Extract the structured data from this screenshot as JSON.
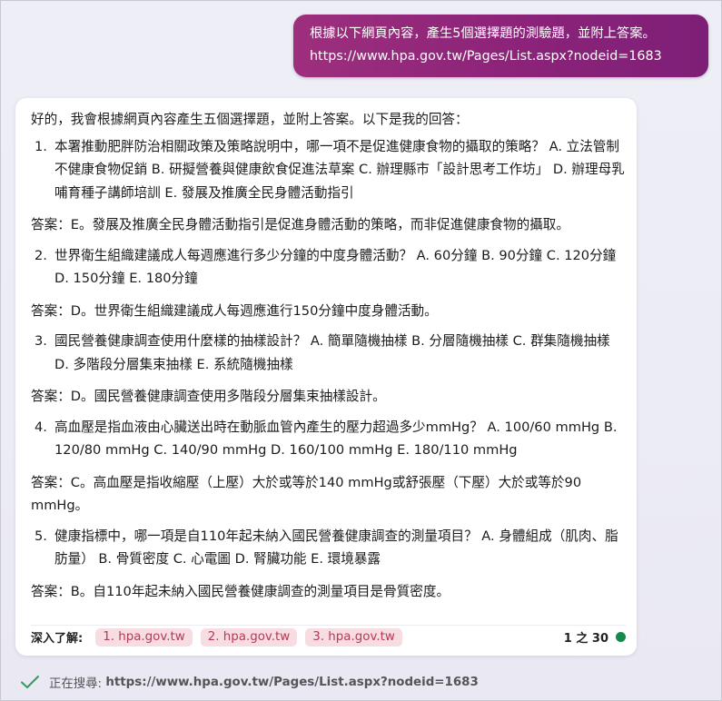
{
  "user_message": {
    "line1": "根據以下網頁內容，產生5個選擇題的測驗題，並附上答案。",
    "line2": "https://www.hpa.gov.tw/Pages/List.aspx?nodeid=1683"
  },
  "response": {
    "intro": "好的，我會根據網頁內容產生五個選擇題，並附上答案。以下是我的回答：",
    "items": [
      {
        "number": "1.",
        "question": "本署推動肥胖防治相關政策及策略說明中，哪一項不是促進健康食物的攝取的策略？ A. 立法管制不健康食物促銷 B. 研擬營養與健康飲食促進法草案 C. 辦理縣市「設計思考工作坊」 D. 辦理母乳哺育種子講師培訓 E. 發展及推廣全民身體活動指引",
        "answer": "答案：E。發展及推廣全民身體活動指引是促進身體活動的策略，而非促進健康食物的攝取。"
      },
      {
        "number": "2.",
        "question": "世界衛生組織建議成人每週應進行多少分鐘的中度身體活動？ A. 60分鐘 B. 90分鐘 C. 120分鐘 D. 150分鐘 E. 180分鐘",
        "answer": "答案：D。世界衛生組織建議成人每週應進行150分鐘中度身體活動。"
      },
      {
        "number": "3.",
        "question": "國民營養健康調查使用什麼樣的抽樣設計？ A. 簡單隨機抽樣 B. 分層隨機抽樣 C. 群集隨機抽樣 D. 多階段分層集束抽樣 E. 系統隨機抽樣",
        "answer": "答案：D。國民營養健康調查使用多階段分層集束抽樣設計。"
      },
      {
        "number": "4.",
        "question": "高血壓是指血液由心臟送出時在動脈血管內產生的壓力超過多少mmHg？ A. 100/60 mmHg B. 120/80 mmHg C. 140/90 mmHg D. 160/100 mmHg E. 180/110 mmHg",
        "answer": "答案：C。高血壓是指收縮壓（上壓）大於或等於140 mmHg或舒張壓（下壓）大於或等於90 mmHg。"
      },
      {
        "number": "5.",
        "question": "健康指標中，哪一項是自110年起未納入國民營養健康調查的測量項目？ A. 身體組成（肌肉、脂肪量） B. 骨質密度 C. 心電圖 D. 腎臟功能 E. 環境暴露",
        "answer": "答案：B。自110年起未納入國民營養健康調查的測量項目是骨質密度。"
      }
    ]
  },
  "footer": {
    "learn_more_label": "深入了解:",
    "references": [
      "1. hpa.gov.tw",
      "2. hpa.gov.tw",
      "3. hpa.gov.tw"
    ],
    "counter": "1 之 30",
    "status_color": "#168a4a"
  },
  "searching": {
    "label": "正在搜尋:",
    "url": "https://www.hpa.gov.tw/Pages/List.aspx?nodeid=1683",
    "icon": "check-icon"
  },
  "colors": {
    "user_bubble": "#8b2379",
    "reference_chip_bg": "#f7dde2",
    "reference_chip_text": "#b23b57"
  }
}
